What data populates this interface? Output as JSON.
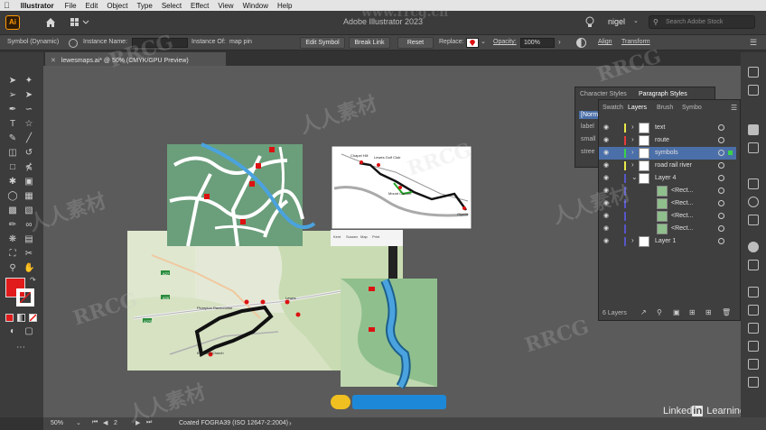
{
  "menubar": {
    "app": "Illustrator",
    "items": [
      "File",
      "Edit",
      "Object",
      "Type",
      "Select",
      "Effect",
      "View",
      "Window",
      "Help"
    ]
  },
  "appbar": {
    "title": "Adobe Illustrator 2023",
    "user": "nigel",
    "search_placeholder": "Search Adobe Stock"
  },
  "controlbar": {
    "selection": "Symbol (Dynamic)",
    "instance_name_label": "Instance Name:",
    "instance_of_label": "Instance Of:",
    "instance_of_value": "map pin",
    "edit_symbol": "Edit Symbol",
    "break_link": "Break Link",
    "reset": "Reset",
    "replace_label": "Replace:",
    "opacity_label": "Opacity:",
    "opacity_value": "100%",
    "align": "Align",
    "transform": "Transform"
  },
  "document": {
    "tab": "lewesmaps.ai* @ 50% (CMYK/GPU Preview)"
  },
  "char_panel": {
    "tabs": [
      "Character Styles",
      "Paragraph Styles"
    ],
    "rows": [
      "[Norm",
      "label",
      "small",
      "stree"
    ]
  },
  "layers_panel": {
    "tabs": [
      "Swatch",
      "Layers",
      "Brush",
      "Symbo"
    ],
    "layers": [
      {
        "name": "text",
        "color": "#e8e84a",
        "thumb": "white",
        "top_level": true
      },
      {
        "name": "route",
        "color": "#e83b3b",
        "thumb": "white",
        "top_level": true
      },
      {
        "name": "symbols",
        "color": "#3bd24a",
        "thumb": "white",
        "top_level": true,
        "selected": true
      },
      {
        "name": "road rail river",
        "color": "#e8e84a",
        "thumb": "white",
        "top_level": true
      },
      {
        "name": "Layer 4",
        "color": "#5656c8",
        "thumb": "white",
        "top_level": true,
        "expanded": true
      },
      {
        "name": "<Rect...",
        "color": "#5656c8",
        "thumb": "green",
        "top_level": false
      },
      {
        "name": "<Rect...",
        "color": "#5656c8",
        "thumb": "green",
        "top_level": false
      },
      {
        "name": "<Rect...",
        "color": "#5656c8",
        "thumb": "green",
        "top_level": false
      },
      {
        "name": "<Rect...",
        "color": "#5656c8",
        "thumb": "green",
        "top_level": false
      },
      {
        "name": "Layer 1",
        "color": "#5656c8",
        "thumb": "white",
        "top_level": true
      }
    ],
    "footer_count": "6 Layers"
  },
  "map_labels": {
    "town1": "Plumpton Racecourse",
    "town2": "Lewes",
    "road1": "A27",
    "road2": "A26",
    "road3": "A275",
    "start": "Kingston Church",
    "inset_chapel": "Chapel Hill",
    "inset_lewes": "Lewes Golf Club",
    "inset_mound": "Mount Caburn",
    "inset_glynde": "Glynde",
    "toolbar_map": [
      "Kent",
      "Sussex",
      "Map",
      "Print"
    ]
  },
  "statusbar": {
    "zoom": "50%",
    "page": "2",
    "profile": "Coated FOGRA39 (ISO 12647-2:2004)"
  },
  "branding": {
    "linkedin": "LinkedIn Learning",
    "linkedin_word": "Linked",
    "in_badge": "in",
    "learning_word": "Learning",
    "watermark_brand": "RRCG",
    "watermark_cn": "人人素材",
    "watermark_url": "www.rrcg.cn"
  },
  "colors": {
    "fill_swatch": "#e11b1b",
    "accent_blue": "#4aa3df"
  }
}
